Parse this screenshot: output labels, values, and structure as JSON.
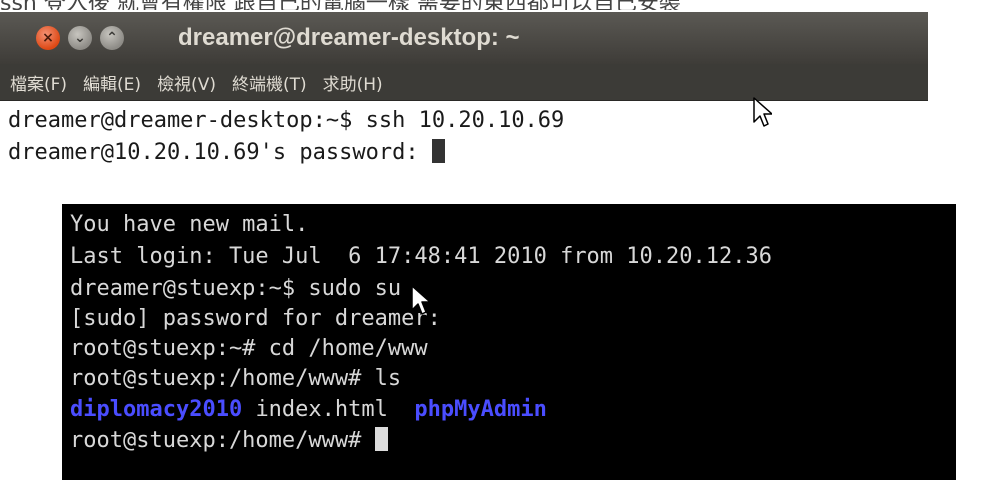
{
  "top_strip_text": "ssh 登入後 就會有權限 跟自己的電腦一樣 需要的東西都可以自己安裝",
  "window1": {
    "title": "dreamer@dreamer-desktop: ~",
    "menu": [
      "檔案(F)",
      "編輯(E)",
      "檢視(V)",
      "終端機(T)",
      "求助(H)"
    ],
    "lines": [
      "dreamer@dreamer-desktop:~$ ssh 10.20.10.69",
      "dreamer@10.20.10.69's password: "
    ]
  },
  "window2": {
    "lines": [
      "You have new mail.",
      "Last login: Tue Jul  6 17:48:41 2010 from 10.20.12.36",
      "dreamer@stuexp:~$ sudo su",
      "[sudo] password for dreamer:",
      "root@stuexp:~# cd /home/www",
      "root@stuexp:/home/www# ls"
    ],
    "ls_output": [
      "diplomacy2010",
      "index.html",
      "phpMyAdmin"
    ],
    "final_prompt": "root@stuexp:/home/www# "
  },
  "colors": {
    "titlebar": "#4a4945",
    "menubar": "#3c3b37",
    "close_button": "#dd4814",
    "directory": "#4a4dff"
  },
  "icons": {
    "close": "close-icon",
    "minimize": "minimize-icon",
    "maximize": "maximize-icon",
    "pointer": "mouse-pointer-icon"
  }
}
